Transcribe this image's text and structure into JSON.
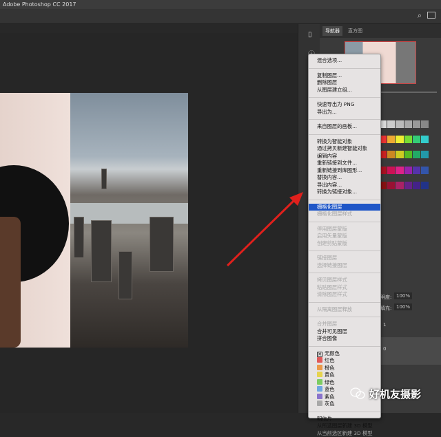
{
  "app": {
    "title": "Adobe Photoshop CC 2017"
  },
  "panel": {
    "tabs": [
      "导航器",
      "直方图"
    ],
    "opacity_label": "明度:",
    "opacity": "100%",
    "fill_label": "填充:",
    "fill": "100%",
    "layer1": "1",
    "layer0": "0"
  },
  "menu": {
    "sections": [
      [
        {
          "label": "混合选项...",
          "state": "normal"
        }
      ],
      [
        {
          "label": "复制图层...",
          "state": "normal"
        },
        {
          "label": "删除图层",
          "state": "normal"
        },
        {
          "label": "从图层建立组...",
          "state": "normal"
        }
      ],
      [
        {
          "label": "快速导出为 PNG",
          "state": "normal"
        },
        {
          "label": "导出为...",
          "state": "normal"
        }
      ],
      [
        {
          "label": "来自图层的画板...",
          "state": "normal"
        }
      ],
      [
        {
          "label": "转换为智能对象",
          "state": "normal"
        },
        {
          "label": "通过拷贝新建智能对象",
          "state": "normal"
        },
        {
          "label": "编辑内容",
          "state": "normal"
        },
        {
          "label": "重新链接到文件...",
          "state": "normal"
        },
        {
          "label": "重新链接到库图形...",
          "state": "normal"
        },
        {
          "label": "替换内容...",
          "state": "normal"
        },
        {
          "label": "导出内容...",
          "state": "normal"
        },
        {
          "label": "转换为链接对象...",
          "state": "normal"
        }
      ],
      [
        {
          "label": "栅格化图层",
          "state": "highlighted"
        },
        {
          "label": "栅格化图层样式",
          "state": "disabled"
        }
      ],
      [
        {
          "label": "停用图层蒙版",
          "state": "disabled"
        },
        {
          "label": "启用矢量蒙版",
          "state": "disabled"
        },
        {
          "label": "创建剪贴蒙版",
          "state": "disabled"
        }
      ],
      [
        {
          "label": "链接图层",
          "state": "disabled"
        },
        {
          "label": "选择链接图层",
          "state": "disabled"
        }
      ],
      [
        {
          "label": "拷贝图层样式",
          "state": "disabled"
        },
        {
          "label": "粘贴图层样式",
          "state": "disabled"
        },
        {
          "label": "清除图层样式",
          "state": "disabled"
        }
      ],
      [
        {
          "label": "从隔离图层释放",
          "state": "disabled"
        }
      ],
      [
        {
          "label": "合并图层",
          "state": "disabled"
        },
        {
          "label": "合并可见图层",
          "state": "normal"
        },
        {
          "label": "拼合图像",
          "state": "normal"
        }
      ],
      [
        {
          "label": "无颜色",
          "state": "normal",
          "color": "none"
        },
        {
          "label": "红色",
          "state": "normal",
          "color": "#e05a5a"
        },
        {
          "label": "橙色",
          "state": "normal",
          "color": "#eb9a4a"
        },
        {
          "label": "黄色",
          "state": "normal",
          "color": "#e6d34e"
        },
        {
          "label": "绿色",
          "state": "normal",
          "color": "#7ccc62"
        },
        {
          "label": "蓝色",
          "state": "normal",
          "color": "#6fa6e0"
        },
        {
          "label": "紫色",
          "state": "normal",
          "color": "#8a73cc"
        },
        {
          "label": "灰色",
          "state": "normal",
          "color": "#a8a8a8"
        }
      ],
      [
        {
          "label": "明信片",
          "state": "normal"
        },
        {
          "label": "从所选图层新建 3D 模型",
          "state": "normal"
        },
        {
          "label": "从当前选区新建 3D 模型",
          "state": "disabled"
        }
      ]
    ]
  },
  "watermark": "好机友摄影",
  "colors": {
    "highlight": "#1f56c7",
    "arrow": "#e0201c"
  }
}
